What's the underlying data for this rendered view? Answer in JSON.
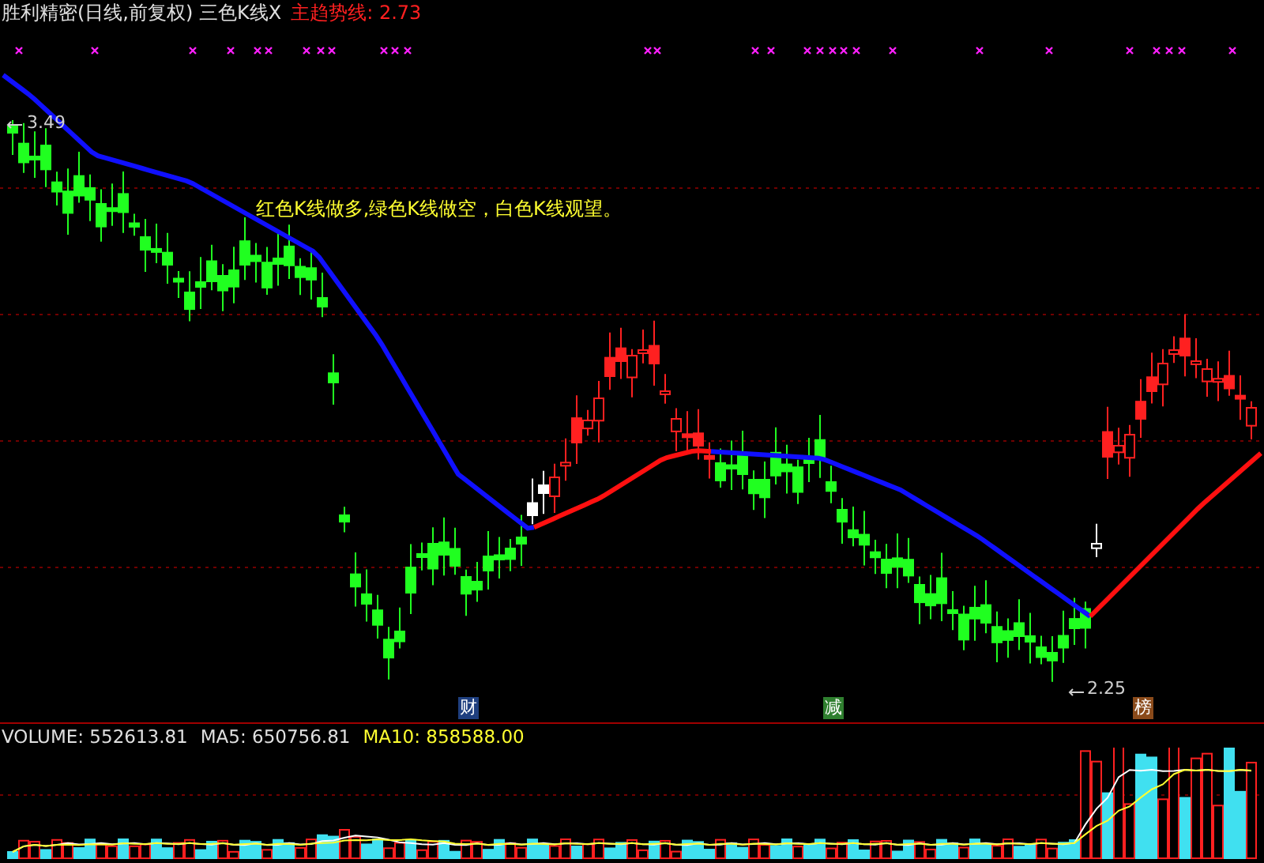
{
  "header": {
    "stock_title": "胜利精密(日线,前复权) 三色K线X",
    "indicator_label": "主趋势线:",
    "indicator_value": "2.73"
  },
  "chart": {
    "high_label": "3.49",
    "low_label": "2.25",
    "note": "红色K线做多,绿色K线做空，白色K线观望。"
  },
  "event_markers": [
    {
      "text": "财",
      "color": "#1f3f7f"
    },
    {
      "text": "减",
      "color": "#2f7f2f"
    },
    {
      "text": "榜",
      "color": "#8a4a1a"
    }
  ],
  "volume": {
    "label": "VOLUME: 552613.81",
    "ma5": "MA5: 650756.81",
    "ma10": "MA10: 858588.00"
  }
}
